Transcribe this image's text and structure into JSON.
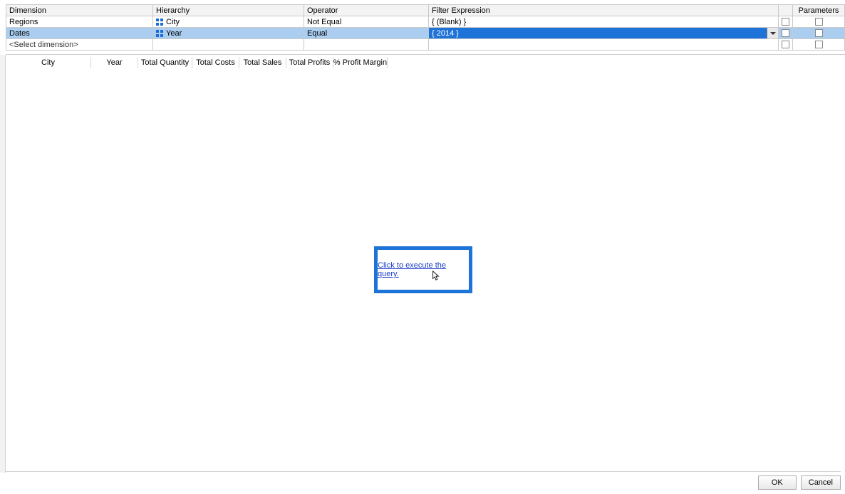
{
  "filterGrid": {
    "headers": {
      "dimension": "Dimension",
      "hierarchy": "Hierarchy",
      "operator": "Operator",
      "filterExpression": "Filter Expression",
      "parameters": "Parameters"
    },
    "rows": [
      {
        "dimension": "Regions",
        "hierarchy": "City",
        "operator": "Not Equal",
        "expression": "{ (Blank) }"
      },
      {
        "dimension": "Dates",
        "hierarchy": "Year",
        "operator": "Equal",
        "expression": "{ 2014 }",
        "selected": true
      }
    ],
    "placeholder": "<Select dimension>"
  },
  "columns": [
    "City",
    "Year",
    "Total Quantity",
    "Total Costs",
    "Total Sales",
    "Total Profits",
    "% Profit Margin"
  ],
  "executeLink": "Click to execute the query.",
  "buttons": {
    "ok": "OK",
    "cancel": "Cancel"
  }
}
